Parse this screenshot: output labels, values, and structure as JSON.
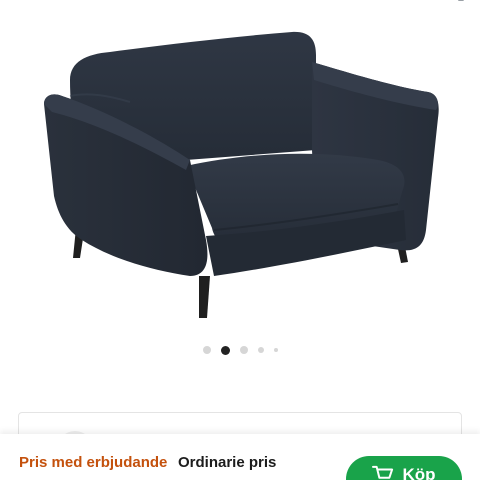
{
  "product": {
    "image_icon": "armchair-image",
    "upholstery_color": "#2a313c",
    "leg_color": "#1f1f1f"
  },
  "gallery": {
    "slide_count": 5,
    "active_slide": 2
  },
  "price_bar": {
    "offer_label": "Pris med erbjudande",
    "regular_label": "Ordinarie pris"
  },
  "buy_button": {
    "label": "Köp",
    "icon": "cart-icon",
    "color": "#19a34a"
  },
  "colors": {
    "offer_accent": "#c4510d",
    "active_dot": "#222222",
    "inactive_dot": "#d6d6d6"
  }
}
